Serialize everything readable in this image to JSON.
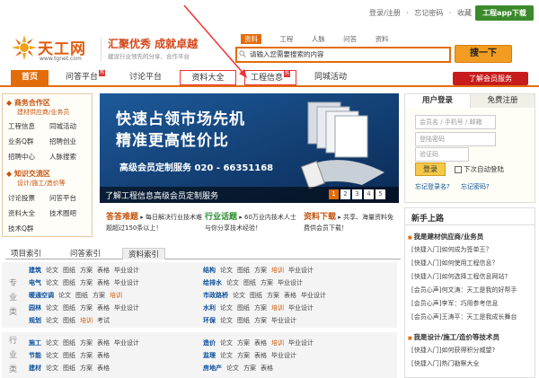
{
  "top": {
    "links": [
      "登录/注册",
      "忘记密码",
      "收藏"
    ],
    "app_button": "工程app下载"
  },
  "logo": {
    "name": "天工网",
    "url": "www.tgnet.com"
  },
  "slogan": {
    "main": "汇聚优秀 成就卓越",
    "sub": "建设行业领先的分享、合作平台"
  },
  "search": {
    "tabs": [
      "资料",
      "工程",
      "人脉",
      "问答",
      "资料"
    ],
    "placeholder": "请输入您需要搜索的内容",
    "button": "搜一下"
  },
  "nav": {
    "items": [
      "首页",
      "问答平台",
      "讨论平台",
      "资料大全",
      "工程信息",
      "同城活动"
    ],
    "hot_badge": "热",
    "member_button": "了解会员服务"
  },
  "sidebar": {
    "section1_title": "商务合作区",
    "section1_sub": "建材供应商/业务员",
    "section1_rows": [
      [
        "工程信息",
        "同城活动"
      ],
      [
        "业务Q群",
        "招聘创业"
      ],
      [
        "招聘中心",
        "人脉搜索"
      ]
    ],
    "section2_title": "知识交流区",
    "section2_sub": "设计/施工/造价等",
    "section2_rows": [
      [
        "讨论投票",
        "问答平台"
      ],
      [
        "资料大全",
        "技术圈吧"
      ],
      [
        "技术Q群",
        ""
      ]
    ]
  },
  "banner": {
    "line1": "快速占领市场先机",
    "line2": "精准更高性价比",
    "line3": "高级会员定制服务 020 - 66351168",
    "caption": "了解工程信息高级会员定制服务",
    "pages": [
      "1",
      "2",
      "3",
      "4",
      "5"
    ]
  },
  "info": [
    {
      "title": "答答难题",
      "text": "每日解决行业技术难题超过150条以上！"
    },
    {
      "title": "行业话题",
      "text": "60万业内技术人士与你分享技术经验！"
    },
    {
      "title": "资料下载",
      "text": "共享、海量资料免费供会员下载！"
    }
  ],
  "lower_tabs": [
    "项目索引",
    "问答索引",
    "资料索引"
  ],
  "grid1": {
    "label": "专业类",
    "rows": [
      {
        "name": "建筑",
        "items": [
          "论文",
          "图纸",
          "方案",
          "表格",
          "毕业设计"
        ]
      },
      {
        "name": "电气",
        "items": [
          "论文",
          "图纸",
          "方案",
          "表格",
          "毕业设计"
        ]
      },
      {
        "name": "暖通空调",
        "items": [
          "论文",
          "图纸",
          "方案",
          "培训"
        ]
      },
      {
        "name": "园林",
        "items": [
          "论文",
          "图纸",
          "方案",
          "表格",
          "毕业设计"
        ]
      },
      {
        "name": "规划",
        "items": [
          "论文",
          "图纸",
          "培训",
          "考试"
        ]
      }
    ],
    "rows_right": [
      {
        "name": "结构",
        "items": [
          "论文",
          "图纸",
          "方案",
          "培训",
          "毕业设计"
        ]
      },
      {
        "name": "给排水",
        "items": [
          "论文",
          "图纸",
          "方案",
          "毕业设计"
        ]
      },
      {
        "name": "市政路桥",
        "items": [
          "论文",
          "图纸",
          "方案",
          "表格",
          "毕业设计"
        ]
      },
      {
        "name": "水利",
        "items": [
          "论文",
          "图纸",
          "方案",
          "培训",
          "毕业设计"
        ]
      },
      {
        "name": "环保",
        "items": [
          "论文",
          "图纸",
          "方案",
          "毕业设计"
        ]
      }
    ]
  },
  "grid2": {
    "label": "行业类",
    "rows": [
      {
        "name": "施工",
        "items": [
          "论文",
          "图纸",
          "方案",
          "表格",
          "毕业设计"
        ]
      },
      {
        "name": "节能",
        "items": [
          "论文",
          "图纸",
          "方案",
          "表格"
        ]
      },
      {
        "name": "建材",
        "items": [
          "论文",
          "图纸",
          "方案",
          "表格"
        ]
      }
    ],
    "rows_right": [
      {
        "name": "造价",
        "items": [
          "论文",
          "方案",
          "表格",
          "培训",
          "毕业设计"
        ]
      },
      {
        "name": "监理",
        "items": [
          "论文",
          "方案",
          "表格",
          "毕业设计"
        ]
      },
      {
        "name": "房地产",
        "items": [
          "论文",
          "方案",
          "表格"
        ]
      }
    ]
  },
  "login": {
    "tab_login": "用户登录",
    "tab_register": "免费注册",
    "user_placeholder": "会员名 / 手机号 / 邮箱",
    "pass_placeholder": "登陆密码",
    "captcha_placeholder": "验证码",
    "login_button": "登录",
    "auto_login": "下次自动登陆",
    "forgot_user": "忘记登录名?",
    "forgot_pass": "忘记密码?"
  },
  "news": {
    "heading": "新手上路",
    "group1_title": "我是建材供应商/业务员",
    "group1_items": [
      "[快捷入门]如何成为签单王？",
      "[快捷入门]如何使用工程信息？",
      "[快捷入门]如何选择工程信息网站?",
      "[会员心声]何文涛：天工是我的好帮手",
      "[会员心声]李军：巧用参考信息",
      "[会员心声]王涛平：天工是我成长舞台"
    ],
    "group2_title": "我是设计/施工/造价等技术员",
    "group2_items": [
      "[快捷入门]如何获得积分威望?",
      "[快捷入门]热门勘察大全"
    ]
  }
}
